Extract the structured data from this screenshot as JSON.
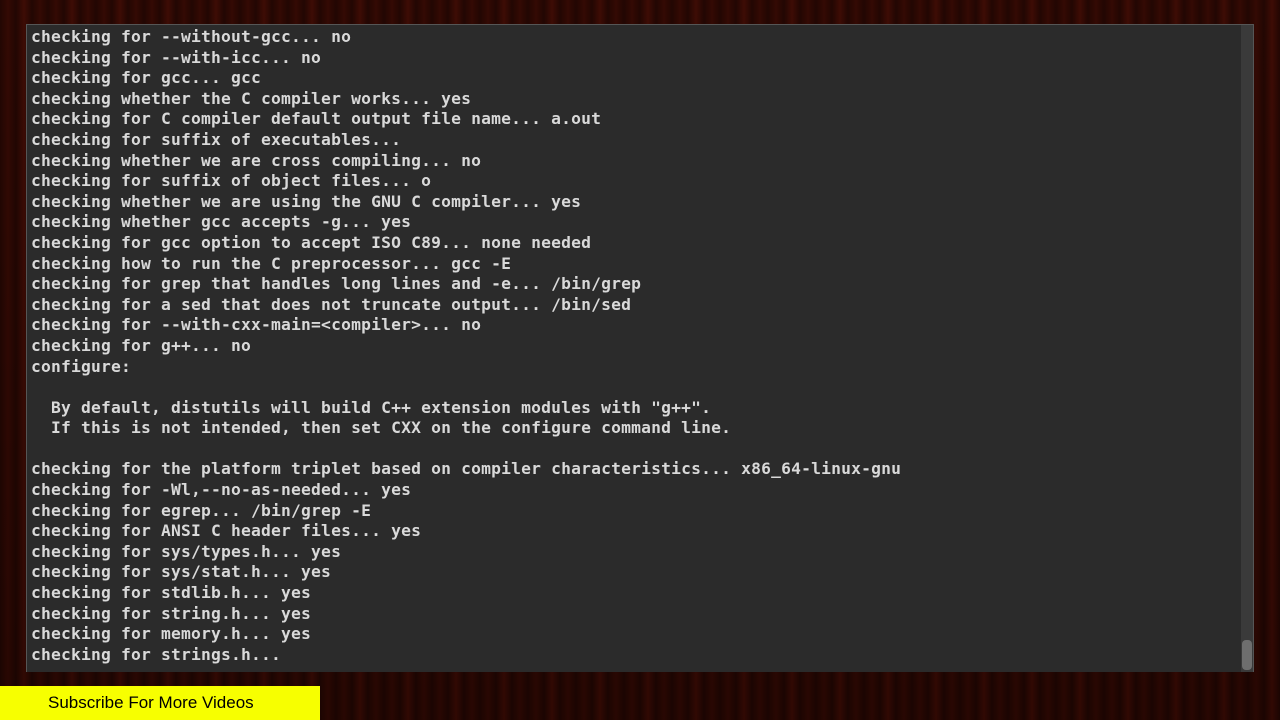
{
  "terminal": {
    "lines": [
      "checking for --without-gcc... no",
      "checking for --with-icc... no",
      "checking for gcc... gcc",
      "checking whether the C compiler works... yes",
      "checking for C compiler default output file name... a.out",
      "checking for suffix of executables... ",
      "checking whether we are cross compiling... no",
      "checking for suffix of object files... o",
      "checking whether we are using the GNU C compiler... yes",
      "checking whether gcc accepts -g... yes",
      "checking for gcc option to accept ISO C89... none needed",
      "checking how to run the C preprocessor... gcc -E",
      "checking for grep that handles long lines and -e... /bin/grep",
      "checking for a sed that does not truncate output... /bin/sed",
      "checking for --with-cxx-main=<compiler>... no",
      "checking for g++... no",
      "configure:",
      "",
      "  By default, distutils will build C++ extension modules with \"g++\".",
      "  If this is not intended, then set CXX on the configure command line.",
      "",
      "checking for the platform triplet based on compiler characteristics... x86_64-linux-gnu",
      "checking for -Wl,--no-as-needed... yes",
      "checking for egrep... /bin/grep -E",
      "checking for ANSI C header files... yes",
      "checking for sys/types.h... yes",
      "checking for sys/stat.h... yes",
      "checking for stdlib.h... yes",
      "checking for string.h... yes",
      "checking for memory.h... yes",
      "checking for strings.h... "
    ]
  },
  "banner": {
    "text": "Subscribe For More Videos"
  }
}
